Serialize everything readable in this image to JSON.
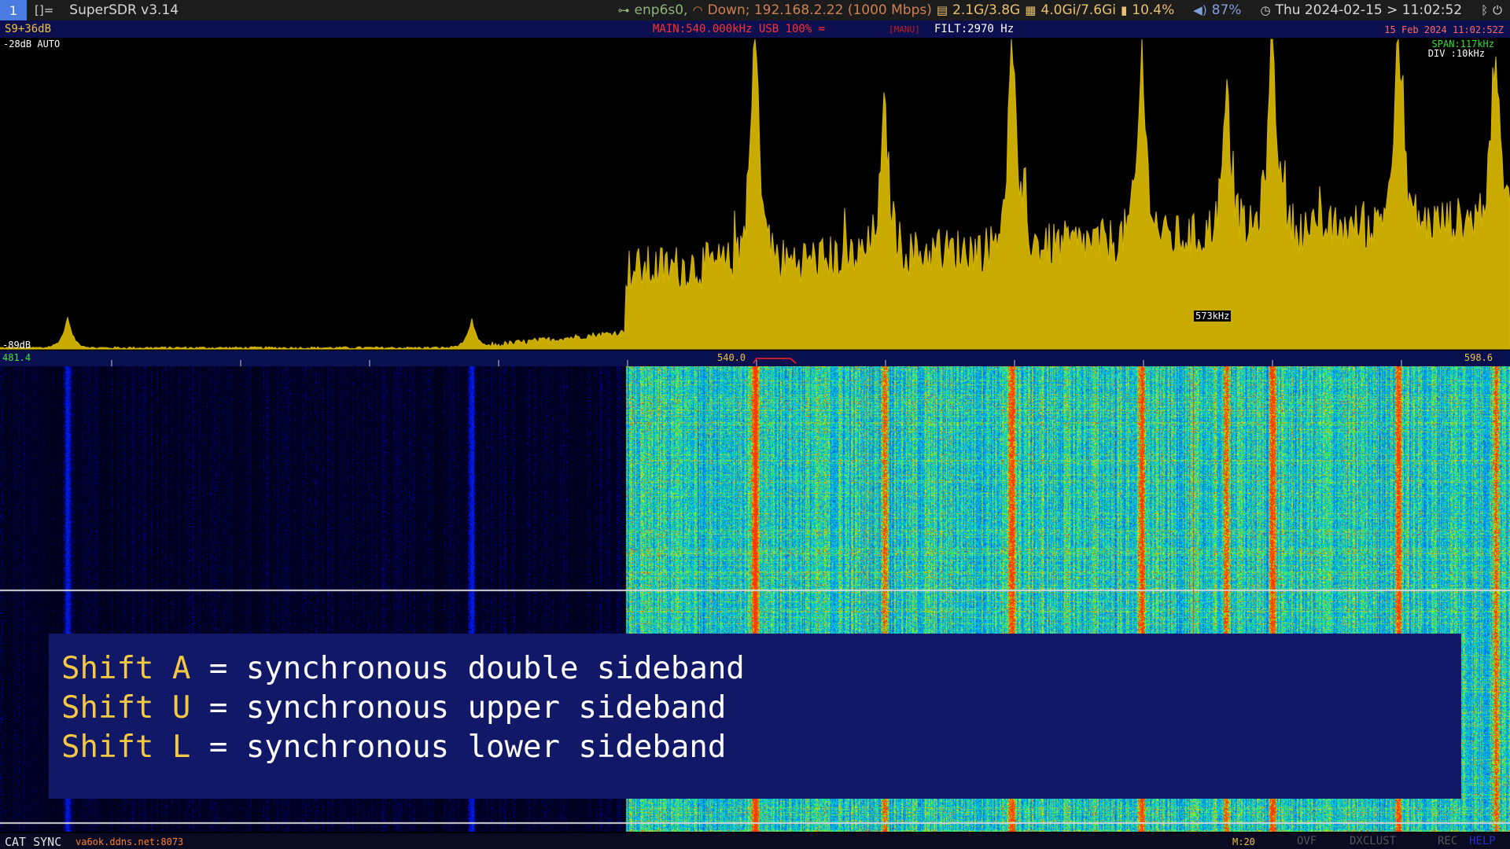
{
  "topbar": {
    "workspace": "1",
    "layout_icon": "[]=",
    "app_title": "SuperSDR v3.14",
    "network": "enp6s0,",
    "network_status": "Down; 192.168.2.22 (1000 Mbps)",
    "disk": "2.1G/3.8G",
    "memory": "4.0Gi/7.6Gi",
    "battery": "10.4%",
    "volume": "87%",
    "clock": "Thu 2024-02-15 > 11:02:52"
  },
  "header": {
    "smeter": "S9+36dB",
    "main": "MAIN:540.000kHz USB 100% =",
    "manu": "[MANU]",
    "filter": "FILT:2970 Hz",
    "datetime": "15 Feb 2024 11:02:52Z"
  },
  "spectrum": {
    "ref_level": "-28dB AUTO",
    "floor_level": "-89dB",
    "span": "SPAN:117kHz",
    "div": "DIV :10kHz",
    "marker": "573kHz"
  },
  "scale": {
    "start": "481.4",
    "center": "540.0",
    "end": "598.6"
  },
  "overlay": {
    "lines": [
      {
        "key": "Shift A",
        "text": " = synchronous double sideband"
      },
      {
        "key": "Shift U",
        "text": " = synchronous upper sideband"
      },
      {
        "key": "Shift L",
        "text": " = synchronous lower sideband"
      }
    ]
  },
  "status": {
    "cat_sync": "CAT SYNC",
    "host": "va6ok.ddns.net:8073",
    "mem": "M:20",
    "ovf": "OVF",
    "dxclust": "DXCLUST",
    "rec": "REC",
    "help": "HELP"
  },
  "colors": {
    "spectrum_fill": "#c9aa00",
    "header_bg": "#0c1050",
    "overlay_bg": "#121868",
    "overlay_key": "#f5c842"
  }
}
